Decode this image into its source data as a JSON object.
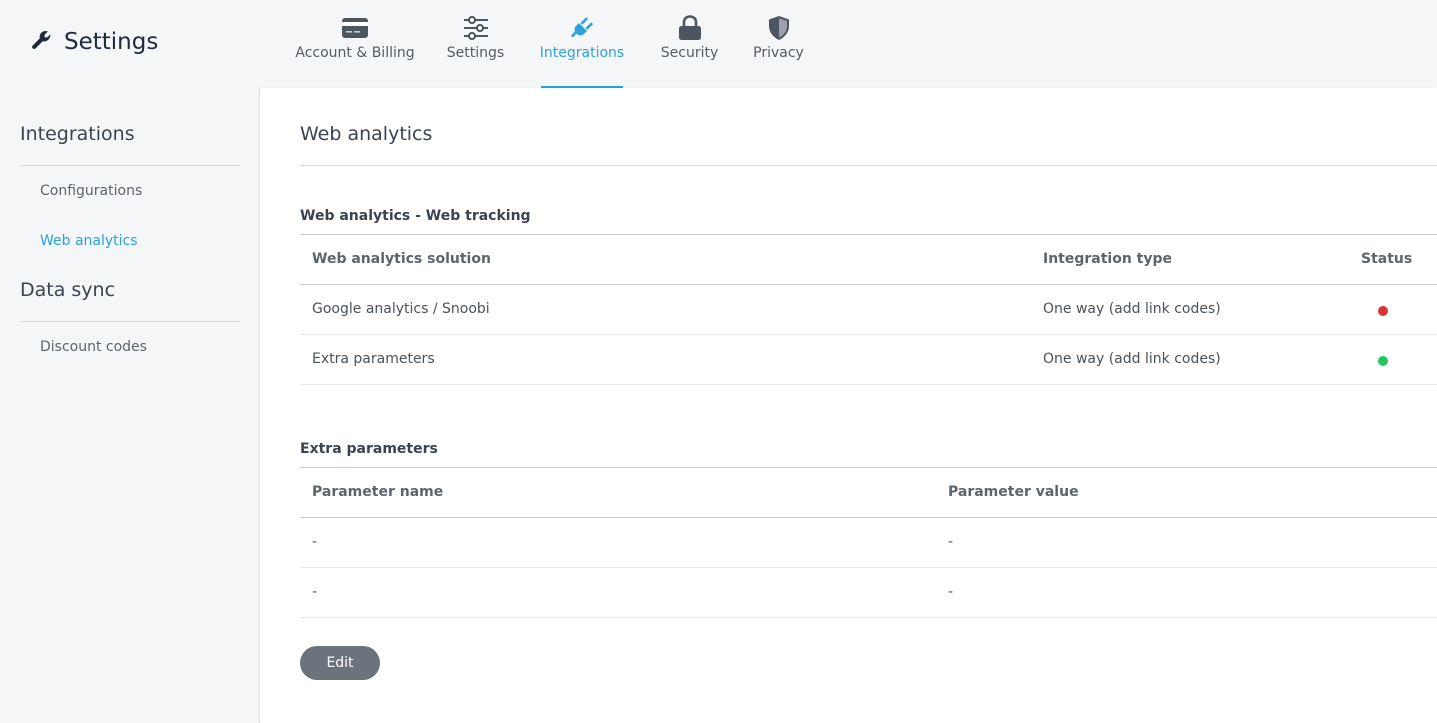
{
  "header": {
    "title": "Settings",
    "tabs": [
      {
        "label": "Account & Billing",
        "icon": "credit-card-icon"
      },
      {
        "label": "Settings",
        "icon": "sliders-icon"
      },
      {
        "label": "Integrations",
        "icon": "plug-icon",
        "active": true
      },
      {
        "label": "Security",
        "icon": "lock-icon"
      },
      {
        "label": "Privacy",
        "icon": "shield-icon"
      }
    ]
  },
  "sidebar": {
    "sections": [
      {
        "title": "Integrations",
        "items": [
          "Configurations",
          "Web analytics"
        ]
      },
      {
        "title": "Data sync",
        "items": [
          "Discount codes"
        ]
      }
    ],
    "active_item": "Web analytics"
  },
  "main": {
    "title": "Web analytics",
    "tracking": {
      "title": "Web analytics - Web tracking",
      "headers": [
        "Web analytics solution",
        "Integration type",
        "Status"
      ],
      "rows": [
        {
          "solution": "Google analytics / Snoobi",
          "type": "One way (add link codes)",
          "status": "inactive"
        },
        {
          "solution": "Extra parameters",
          "type": "One way (add link codes)",
          "status": "active"
        }
      ]
    },
    "params": {
      "title": "Extra parameters",
      "headers": [
        "Parameter name",
        "Parameter value"
      ],
      "rows": [
        {
          "name": "-",
          "value": "-"
        },
        {
          "name": "-",
          "value": "-"
        }
      ]
    },
    "edit_label": "Edit"
  },
  "colors": {
    "accent": "#2aa3d8",
    "status_inactive": "#d9343a",
    "status_active": "#22c55e"
  }
}
